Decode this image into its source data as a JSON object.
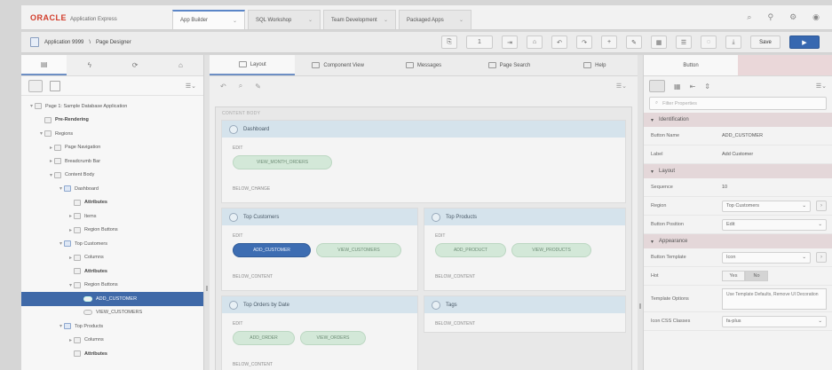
{
  "header": {
    "logo_oracle": "ORACLE",
    "logo_product": "Application Express",
    "tabs": [
      {
        "label": "App Builder",
        "active": true
      },
      {
        "label": "SQL Workshop",
        "active": false
      },
      {
        "label": "Team Development",
        "active": false
      },
      {
        "label": "Packaged Apps",
        "active": false
      }
    ],
    "icons": [
      "search-icon",
      "help-icon",
      "settings-icon",
      "user-icon"
    ]
  },
  "toolbar": {
    "application": "Application 9999",
    "separator": "\\",
    "page_designer": "Page Designer",
    "page_number": "1",
    "save_label": "Save",
    "run_label": "▶"
  },
  "left_pane": {
    "tabs": [
      "rendering-icon",
      "dynamic-actions-icon",
      "processing-icon",
      "shared-components-icon"
    ],
    "tree": [
      {
        "indent": 0,
        "label": "Page 1: Sample Database Application",
        "twisty": "▾",
        "icon": "page"
      },
      {
        "indent": 1,
        "label": "Pre-Rendering",
        "twisty": "",
        "icon": "folder",
        "bold": true
      },
      {
        "indent": 1,
        "label": "Regions",
        "twisty": "▾",
        "icon": "folder"
      },
      {
        "indent": 2,
        "label": "Page Navigation",
        "twisty": "▸",
        "icon": "folder"
      },
      {
        "indent": 2,
        "label": "Breadcrumb Bar",
        "twisty": "▸",
        "icon": "folder"
      },
      {
        "indent": 2,
        "label": "Content Body",
        "twisty": "▾",
        "icon": "folder"
      },
      {
        "indent": 3,
        "label": "Dashboard",
        "twisty": "▾",
        "icon": "region"
      },
      {
        "indent": 4,
        "label": "Attributes",
        "twisty": "",
        "icon": "item",
        "bold": true
      },
      {
        "indent": 4,
        "label": "Items",
        "twisty": "▸",
        "icon": "folder"
      },
      {
        "indent": 4,
        "label": "Region Buttons",
        "twisty": "▸",
        "icon": "folder"
      },
      {
        "indent": 3,
        "label": "Top Customers",
        "twisty": "▾",
        "icon": "region"
      },
      {
        "indent": 4,
        "label": "Columns",
        "twisty": "▸",
        "icon": "folder"
      },
      {
        "indent": 4,
        "label": "Attributes",
        "twisty": "",
        "icon": "item",
        "bold": true
      },
      {
        "indent": 4,
        "label": "Region Buttons",
        "twisty": "▾",
        "icon": "folder"
      },
      {
        "indent": 5,
        "label": "ADD_CUSTOMER",
        "twisty": "",
        "icon": "button",
        "selected": true
      },
      {
        "indent": 5,
        "label": "VIEW_CUSTOMERS",
        "twisty": "",
        "icon": "button"
      },
      {
        "indent": 3,
        "label": "Top Products",
        "twisty": "▾",
        "icon": "region"
      },
      {
        "indent": 4,
        "label": "Columns",
        "twisty": "▸",
        "icon": "folder"
      },
      {
        "indent": 4,
        "label": "Attributes",
        "twisty": "",
        "icon": "item",
        "bold": true
      }
    ]
  },
  "center": {
    "tabs": [
      {
        "label": "Layout",
        "active": true
      },
      {
        "label": "Component View",
        "active": false
      },
      {
        "label": "Messages",
        "active": false
      },
      {
        "label": "Page Search",
        "active": false
      },
      {
        "label": "Help",
        "active": false
      }
    ],
    "canvas_label": "CONTENT BODY",
    "regions": {
      "dashboard": {
        "title": "Dashboard",
        "slot": "EDIT",
        "buttons": [
          "VIEW_MONTH_ORDERS"
        ],
        "slot2": "BELOW_CHANGE"
      },
      "top_customers": {
        "title": "Top Customers",
        "slot": "EDIT",
        "buttons": [
          "ADD_CUSTOMER",
          "VIEW_CUSTOMERS"
        ],
        "slot2": "BELOW_CONTENT"
      },
      "top_products": {
        "title": "Top Products",
        "slot": "EDIT",
        "buttons": [
          "ADD_PRODUCT",
          "VIEW_PRODUCTS"
        ],
        "slot2": "BELOW_CONTENT"
      },
      "top_orders": {
        "title": "Top Orders by Date",
        "slot": "EDIT",
        "buttons": [
          "ADD_ORDER",
          "VIEW_ORDERS"
        ],
        "slot2": "BELOW_CONTENT"
      },
      "tags": {
        "title": "Tags",
        "slot": "BELOW_CONTENT"
      }
    }
  },
  "right_pane": {
    "tabs": [
      {
        "label": "Button",
        "active": true
      },
      {
        "label": "",
        "active": false
      }
    ],
    "search_placeholder": "Filter Properties",
    "sections": {
      "identification": "Identification",
      "layout": "Layout",
      "appearance": "Appearance"
    },
    "props": {
      "button_name_label": "Button Name",
      "button_name": "ADD_CUSTOMER",
      "label_label": "Label",
      "label": "Add Customer",
      "sequence_label": "Sequence",
      "sequence": "10",
      "region_label": "Region",
      "region": "Top Customers",
      "position_label": "Button Position",
      "position": "Edit",
      "template_label": "Button Template",
      "template": "Icon",
      "hot_label": "Hot",
      "hot_yes": "Yes",
      "hot_no": "No",
      "template_options_label": "Template Options",
      "template_options": "Use Template Defaults, Remove UI Decoration",
      "icon_label": "Icon CSS Classes",
      "icon": "fa-plus"
    }
  }
}
